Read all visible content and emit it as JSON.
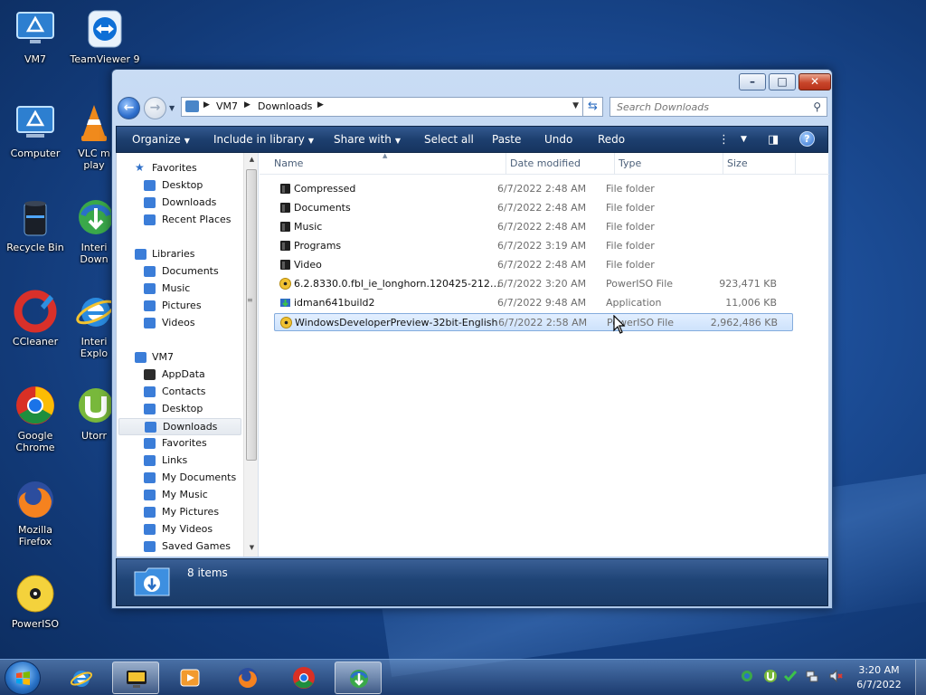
{
  "colors": {
    "accent": "#1d3f6f",
    "selection_bg": "#cde2fc",
    "selection_border": "#84acdd",
    "folder_icon": "#1f1f1f",
    "iso_icon": "#f1c232"
  },
  "desktop": {
    "icons": [
      {
        "label": "VM7",
        "icon": "monitor-icon"
      },
      {
        "label": "TeamViewer 9",
        "icon": "teamviewer-icon"
      },
      {
        "label": "Computer",
        "icon": "computer-icon"
      },
      {
        "label": "VLC m...\nplay...",
        "icon": "vlc-icon"
      },
      {
        "label": "Recycle Bin",
        "icon": "recycle-bin-icon"
      },
      {
        "label": "Interi...\nDown...",
        "icon": "idm-icon"
      },
      {
        "label": "CCleaner",
        "icon": "ccleaner-icon"
      },
      {
        "label": "Interi...\nExplo...",
        "icon": "ie-icon"
      },
      {
        "label": "Google Chrome",
        "icon": "chrome-icon"
      },
      {
        "label": "Utorr...",
        "icon": "utorrent-icon"
      },
      {
        "label": "Mozilla Firefox",
        "icon": "firefox-icon"
      },
      {
        "label": "PowerISO",
        "icon": "poweriso-icon"
      }
    ],
    "labels": {
      "vm7": "VM7",
      "teamviewer": "TeamViewer 9",
      "computer": "Computer",
      "vlc1": "VLC m",
      "vlc2": "play",
      "recycle": "Recycle Bin",
      "idm1": "Interi",
      "idm2": "Down",
      "ccleaner": "CCleaner",
      "ie1": "Interi",
      "ie2": "Explo",
      "chrome1": "Google",
      "chrome2": "Chrome",
      "utorrent": "Utorr",
      "firefox1": "Mozilla",
      "firefox2": "Firefox",
      "poweriso": "PowerISO"
    }
  },
  "window": {
    "controls": {
      "minimize": "–",
      "maximize": "□",
      "close": "✕"
    },
    "breadcrumb": [
      "VM7",
      "Downloads"
    ],
    "search_placeholder": "Search Downloads",
    "toolbar": {
      "organize": "Organize",
      "include_in_library": "Include in library",
      "share_with": "Share with",
      "select_all": "Select all",
      "paste": "Paste",
      "undo": "Undo",
      "redo": "Redo"
    },
    "nav": {
      "favorites": "Favorites",
      "fav_items": [
        "Desktop",
        "Downloads",
        "Recent Places"
      ],
      "libraries": "Libraries",
      "lib_items": [
        "Documents",
        "Music",
        "Pictures",
        "Videos"
      ],
      "vm7": "VM7",
      "vm7_items": [
        "AppData",
        "Contacts",
        "Desktop",
        "Downloads",
        "Favorites",
        "Links",
        "My Documents",
        "My Music",
        "My Pictures",
        "My Videos",
        "Saved Games"
      ]
    },
    "columns": {
      "name": "Name",
      "date": "Date modified",
      "type": "Type",
      "size": "Size"
    },
    "files": [
      {
        "name": "Compressed",
        "date": "6/7/2022 2:48 AM",
        "type": "File folder",
        "size": "",
        "icon": "folder-icon"
      },
      {
        "name": "Documents",
        "date": "6/7/2022 2:48 AM",
        "type": "File folder",
        "size": "",
        "icon": "folder-icon"
      },
      {
        "name": "Music",
        "date": "6/7/2022 2:48 AM",
        "type": "File folder",
        "size": "",
        "icon": "folder-icon"
      },
      {
        "name": "Programs",
        "date": "6/7/2022 3:19 AM",
        "type": "File folder",
        "size": "",
        "icon": "folder-icon"
      },
      {
        "name": "Video",
        "date": "6/7/2022 2:48 AM",
        "type": "File folder",
        "size": "",
        "icon": "folder-icon"
      },
      {
        "name": "6.2.8330.0.fbl_ie_longhorn.120425-2121_x8...",
        "date": "6/7/2022 3:20 AM",
        "type": "PowerISO File",
        "size": "923,471 KB",
        "icon": "disc-icon"
      },
      {
        "name": "idman641build2",
        "date": "6/7/2022 9:48 AM",
        "type": "Application",
        "size": "11,006 KB",
        "icon": "installer-icon"
      },
      {
        "name": "WindowsDeveloperPreview-32bit-English",
        "date": "6/7/2022 2:58 AM",
        "type": "PowerISO File",
        "size": "2,962,486 KB",
        "icon": "disc-icon"
      }
    ],
    "status": {
      "count": "8 items"
    }
  },
  "taskbar": {
    "clock_time": "3:20 AM",
    "clock_date": "6/7/2022",
    "apps": [
      "ie-icon",
      "vm-icon",
      "media-player-icon",
      "firefox-icon",
      "chrome-icon",
      "idm-icon"
    ]
  }
}
